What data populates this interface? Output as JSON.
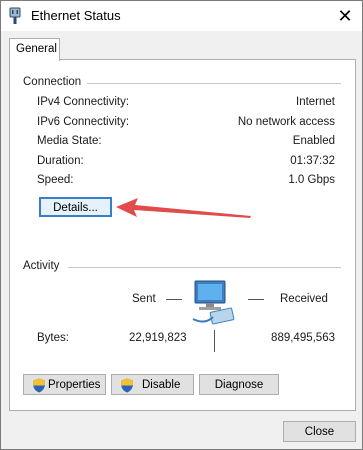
{
  "window": {
    "title": "Ethernet Status",
    "close_glyph": "✕"
  },
  "tabs": [
    {
      "label": "General"
    }
  ],
  "connection": {
    "group_label": "Connection",
    "rows": [
      {
        "label": "IPv4 Connectivity:",
        "value": "Internet"
      },
      {
        "label": "IPv6 Connectivity:",
        "value": "No network access"
      },
      {
        "label": "Media State:",
        "value": "Enabled"
      },
      {
        "label": "Duration:",
        "value": "01:37:32"
      },
      {
        "label": "Speed:",
        "value": "1.0 Gbps"
      }
    ],
    "details_button": "Details..."
  },
  "activity": {
    "group_label": "Activity",
    "sent_label": "Sent",
    "received_label": "Received",
    "bytes_label": "Bytes:",
    "bytes_sent": "22,919,823",
    "bytes_received": "889,495,563"
  },
  "buttons": {
    "properties": "Properties",
    "disable": "Disable",
    "diagnose": "Diagnose",
    "close": "Close"
  },
  "icons": {
    "title": "ethernet-plug-icon",
    "network": "network-computer-icon",
    "shield": "uac-shield-icon",
    "arrow": "red-annotation-arrow"
  },
  "colors": {
    "focus_border": "#3a7dc8",
    "arrow": "#e04b4b"
  }
}
